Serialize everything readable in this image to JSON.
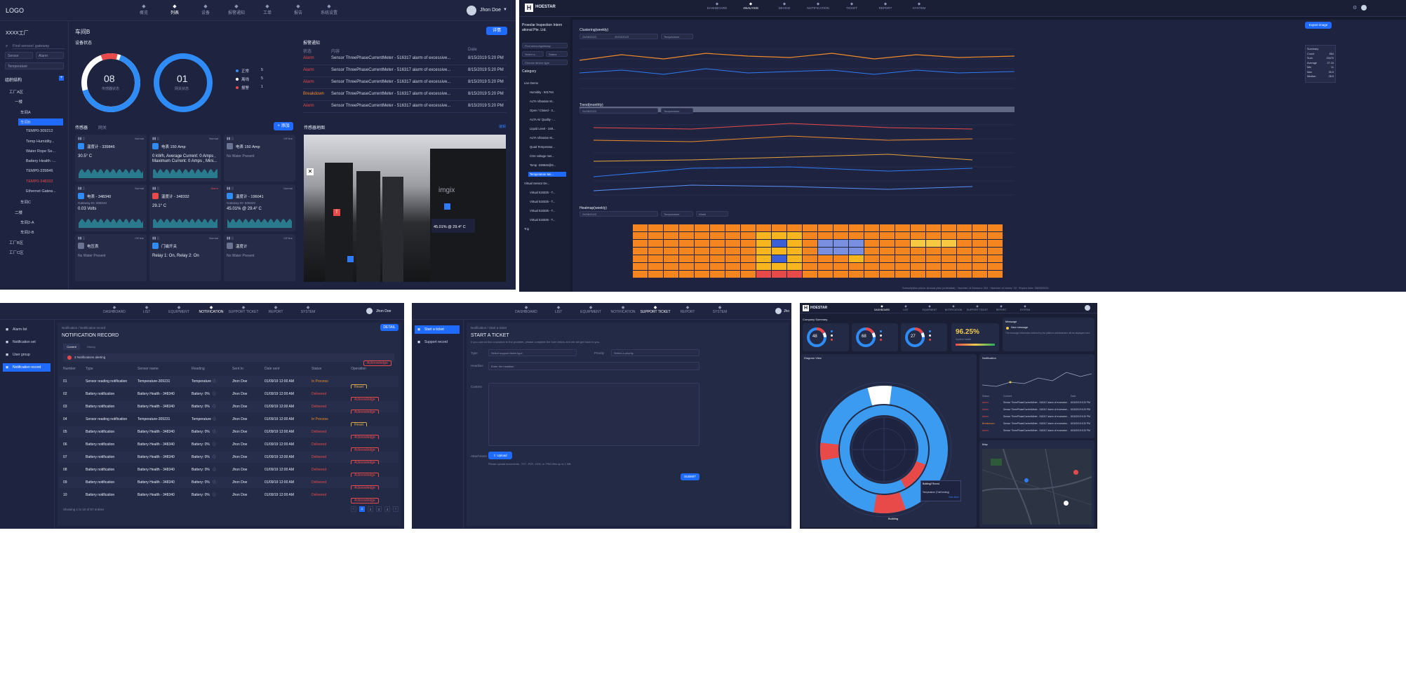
{
  "p1": {
    "logo": "LOGO",
    "nav": [
      "概览",
      "列表",
      "设备",
      "报警通知",
      "工单",
      "报告",
      "系统设置"
    ],
    "user": "Jhon Doe",
    "factory": "XXXX工厂",
    "search_placeholder": "Find sensor/ gateway",
    "filters": [
      "Sensor",
      "Alarm",
      "Temperature"
    ],
    "org_title": "组织结构",
    "tree": [
      "工厂A区",
      "一楼",
      "车间A",
      "车间B",
      "TEMP0-309212",
      "Temp Humidity...",
      "Water Rope Se...",
      "Battery Health -...",
      "TEMP0-339846",
      "TEMP0-348332",
      "Ethernet Gatew...",
      "车间C",
      "二楼",
      "车间2-A",
      "车间2-B",
      "工厂B区",
      "工厂C区"
    ],
    "section_title": "车间B",
    "detail_btn": "详情",
    "device_status": "设备状态",
    "donut1_value": "08",
    "donut1_label": "传感器状态",
    "donut2_value": "01",
    "donut2_label": "网关状态",
    "legend": [
      {
        "label": "正常",
        "value": "5"
      },
      {
        "label": "离线",
        "value": "5"
      },
      {
        "label": "报警",
        "value": "1"
      }
    ],
    "alarm_title": "报警通知",
    "alarm_cols": [
      "状态",
      "内容",
      "Date"
    ],
    "alarms": [
      {
        "status": "Alarm",
        "content": "Sensor ThreePhaseCurrentMeter - 516317 alarm of excessive...",
        "date": "8/15/2019 5:20 PM"
      },
      {
        "status": "Alarm",
        "content": "Sensor ThreePhaseCurrentMeter - 516317 alarm of excessive...",
        "date": "8/15/2019 5:20 PM"
      },
      {
        "status": "Alarm",
        "content": "Sensor ThreePhaseCurrentMeter - 516317 alarm of excessive...",
        "date": "8/15/2019 5:20 PM"
      },
      {
        "status": "Breakdown",
        "content": "Sensor ThreePhaseCurrentMeter - 516317 alarm of excessive...",
        "date": "8/15/2019 5:20 PM"
      },
      {
        "status": "Alarm",
        "content": "Sensor ThreePhaseCurrentMeter - 516317 alarm of excessive...",
        "date": "8/15/2019 5:20 PM"
      }
    ],
    "tabs": [
      "传感器",
      "网关"
    ],
    "add_btn": "+ 添加",
    "map_title": "传感器地图",
    "map_link": "编辑",
    "sensors": [
      {
        "name": "温度计 - 339846",
        "value": "30.5° C",
        "tag": "Normal"
      },
      {
        "name": "电表 150 Amp",
        "value": "0 kWh, Average Current: 0 Amps , Maximum Current: 0 Amps , Mini...",
        "tag": "Normal"
      },
      {
        "name": "电表 150 Amp",
        "value": "No Water Present",
        "tag": "Off line"
      },
      {
        "name": "电表 - 348340",
        "value": "0.03 Volts",
        "tag": "Normal"
      },
      {
        "name": "温度计 - 348332",
        "value": "29.1° C",
        "tag": "Alarm"
      },
      {
        "name": "温度计 - 196041",
        "value": "45.01% @ 29.4° C",
        "tag": "Normal"
      },
      {
        "name": "电压表",
        "value": "No Water Present",
        "tag": "Off line"
      },
      {
        "name": "门磁开关",
        "value": "Relay 1: On, Relay 2: On",
        "tag": "Normal"
      },
      {
        "name": "温度计",
        "value": "No Water Present",
        "tag": "Off line"
      }
    ],
    "gateway_id": "Gateway ID: 606040",
    "map_tooltip": "45.01% @ 29.4° C",
    "map_brand": "imgix"
  },
  "p2": {
    "brand": "HOESTAR",
    "nav": [
      "DASHBOARD",
      "ANALYSIS",
      "DEVICE",
      "NOTIFICATION",
      "TICKET",
      "REPORT",
      "SYSTEM"
    ],
    "company": "Proeolar Inspection Intern ational Pte. Ltd.",
    "search_placeholder": "Find sensor/gateway",
    "filters": [
      "Select a...",
      "Status",
      "Choose device type"
    ],
    "category": "Category",
    "tree": [
      "Live Demo",
      "Humidity - 501764",
      "ALTA Vibration M...",
      "Open / Closed - 3...",
      "ALTA Air Quality -...",
      "Liquid Level - 249...",
      "ALTA Vibration M...",
      "Quad Temperatur...",
      "CO4 voltage met...",
      "Temp -339846@S...",
      "Temperature Me...",
      "Virtual Sensor De...",
      "Virtual 518335 - T...",
      "Virtual 518335 - T...",
      "Virtual 518335 - T...",
      "Virtual 518335 - T...",
      "Trip"
    ],
    "export_btn": "Export image",
    "clustering_title": "Clustering(weekly)",
    "trend_title": "Trend(monthly)",
    "heatmap_title": "Heatmap(weekly)",
    "date_from": "24/08/2023",
    "date_to": "30/03/2023",
    "metric": "Temperature",
    "period": "Week",
    "summary": [
      {
        "k": "Summary",
        "v": ""
      },
      {
        "k": "Count",
        "v": "864"
      },
      {
        "k": "Sum",
        "v": "23470"
      },
      {
        "k": "Average",
        "v": "27.16"
      },
      {
        "k": "Min",
        "v": "11"
      },
      {
        "k": "Max",
        "v": "30.5"
      },
      {
        "k": "Median",
        "v": "28.5"
      }
    ],
    "footer": "Subscription plans: Annual plan (unlimited) · Number of Sensors: 201 · Number of Users: 10 · Expire time: 28/05/2021"
  },
  "p3": {
    "nav": [
      "DASHBOARD",
      "LIST",
      "EQUIPMENT",
      "NOTIFICATION",
      "SUPPORT TICKET",
      "REPORT",
      "SYSTEM"
    ],
    "user": "Jhon Doe",
    "side": [
      "Alarm list",
      "Notification set",
      "User group",
      "Notification record"
    ],
    "breadcrumb": "Notification / Notification record",
    "title": "NOTIFICATION RECORD",
    "detail_btn": "DETAIL",
    "tabs": [
      "Current",
      "History"
    ],
    "alert": "3 Notifications alerting",
    "cols": [
      "Number",
      "Type",
      "Sensor name",
      "Reading",
      "Sent to",
      "Date sent",
      "Status",
      "Operation"
    ],
    "rows": [
      [
        "01",
        "Sensor reading notification",
        "Temperature-309231",
        "Temperature",
        "Jhon Doe",
        "01/09/19 12:00 AM",
        "In Process",
        "Reset"
      ],
      [
        "02",
        "Battery notification",
        "Battery Health - 348340",
        "Battery: 0%",
        "Jhon Doe",
        "01/09/19 12:00 AM",
        "Delivered",
        "Acknowledge"
      ],
      [
        "03",
        "Battery notification",
        "Battery Health - 348340",
        "Battery: 0%",
        "Jhon Doe",
        "01/09/19 12:00 AM",
        "Delivered",
        "Acknowledge"
      ],
      [
        "04",
        "Sensor reading notification",
        "Temperature-309231",
        "Temperature",
        "Jhon Doe",
        "01/09/19 12:00 AM",
        "In Process",
        "Reset"
      ],
      [
        "05",
        "Battery notification",
        "Battery Health - 348340",
        "Battery: 0%",
        "Jhon Doe",
        "01/09/19 12:00 AM",
        "Delivered",
        "Acknowledge"
      ],
      [
        "06",
        "Battery notification",
        "Battery Health - 348340",
        "Battery: 0%",
        "Jhon Doe",
        "01/09/19 12:00 AM",
        "Delivered",
        "Acknowledge"
      ],
      [
        "07",
        "Battery notification",
        "Battery Health - 348340",
        "Battery: 0%",
        "Jhon Doe",
        "01/09/19 12:00 AM",
        "Delivered",
        "Acknowledge"
      ],
      [
        "08",
        "Battery notification",
        "Battery Health - 348340",
        "Battery: 0%",
        "Jhon Doe",
        "01/09/19 12:00 AM",
        "Delivered",
        "Acknowledge"
      ],
      [
        "09",
        "Battery notification",
        "Battery Health - 348340",
        "Battery: 0%",
        "Jhon Doe",
        "01/09/19 12:00 AM",
        "Delivered",
        "Acknowledge"
      ],
      [
        "10",
        "Battery notification",
        "Battery Health - 348340",
        "Battery: 0%",
        "Jhon Doe",
        "01/09/19 12:00 AM",
        "Delivered",
        "Acknowledge"
      ]
    ],
    "footer": "Showing 1 to 10 of 57 entries",
    "pages": [
      "1",
      "2",
      "3",
      "4"
    ]
  },
  "p4": {
    "nav": [
      "DASHBOARD",
      "LIST",
      "EQUIPMENT",
      "NOTIFICATION",
      "SUPPORT TICKET",
      "REPORT",
      "SYSTEM"
    ],
    "user": "Jho",
    "side": [
      "Start a ticket",
      "Support record"
    ],
    "breadcrumb": "Notification / Start a ticket",
    "title": "START A TICKET",
    "intro": "If you cannot find a solution to the problem, please complete the form below and we will get back to you.",
    "type_label": "Type",
    "type_ph": "Select support ticket type",
    "priority_label": "Priority",
    "priority_ph": "Select a priority",
    "headline_label": "Headline",
    "headline_ph": "Enter the headline",
    "content_label": "Content",
    "attach_label": "Attachment",
    "upload_btn": "Upload",
    "attach_hint": "Please upload documents, .TXT, .PDF, .DOC or .PNG files up to 1 MB",
    "submit_btn": "SUBMIT"
  },
  "p5": {
    "brand": "HOESTAR",
    "nav": [
      "DASHBOARD",
      "LIST",
      "EQUIPMENT",
      "NOTIFICATION",
      "SUPPORT TICKET",
      "REPORT",
      "SYSTEM"
    ],
    "company_summary": "Company Summary",
    "donuts": [
      "48",
      "68",
      "27"
    ],
    "percent": "96.25%",
    "percent_label": "System health",
    "message_title": "Message",
    "message_item": "New message",
    "message_text": "The message information entered by the platform administrator will be displayed here.",
    "diagram_title": "Diagram View",
    "notif_title": "Notification",
    "notif_cols": [
      "Status",
      "Content",
      "Date"
    ],
    "notif_rows": [
      {
        "s": "Alarm",
        "c": "Sensor ThreePhaseCurrentMeter - 516317 alarm of excessive...",
        "d": "8/15/2019 5:20 PM"
      },
      {
        "s": "Alarm",
        "c": "Sensor ThreePhaseCurrentMeter - 516317 alarm of excessive...",
        "d": "8/15/2019 5:20 PM"
      },
      {
        "s": "Alarm",
        "c": "Sensor ThreePhaseCurrentMeter - 516317 alarm of excessive...",
        "d": "8/15/2019 5:20 PM"
      },
      {
        "s": "Breakdown",
        "c": "Sensor ThreePhaseCurrentMeter - 516317 alarm of excessive...",
        "d": "8/15/2019 5:20 PM"
      },
      {
        "s": "Alarm",
        "c": "Sensor ThreePhaseCurrentMeter - 516317 alarm of excessive...",
        "d": "8/15/2019 5:20 PM"
      }
    ],
    "map_title": "Map",
    "ring_label": "Building",
    "popup_title": "Building2 Room1",
    "popup_text": "Temperature (Triall testing)",
    "popup_link": "View More"
  }
}
